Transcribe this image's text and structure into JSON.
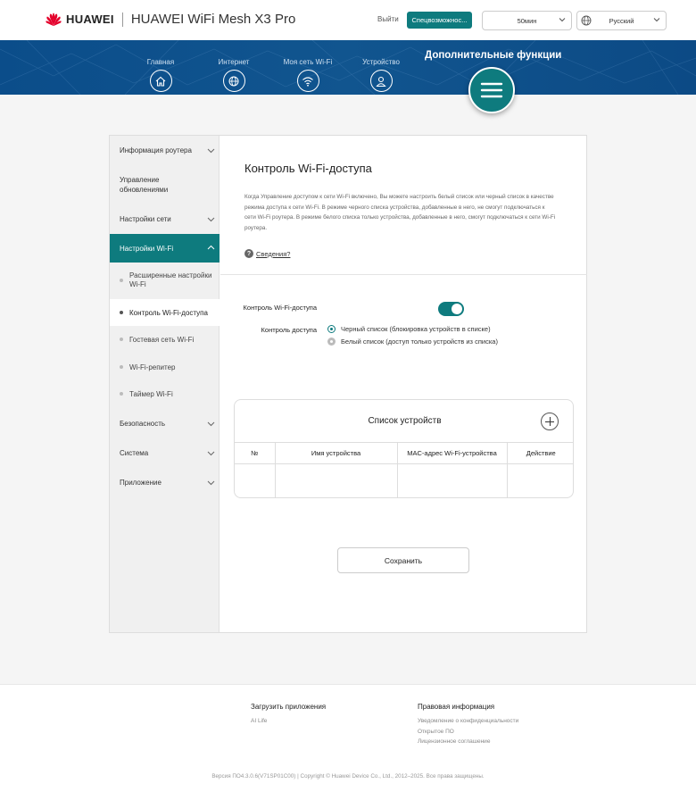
{
  "header": {
    "brand": "HUAWEI",
    "product": "HUAWEI WiFi Mesh X3 Pro",
    "logout": "Выйти",
    "accessibility": "Спецвозможнос...",
    "timeout": "50мин",
    "language": "Русский"
  },
  "nav": {
    "items": [
      {
        "label": "Главная",
        "icon": "home-icon"
      },
      {
        "label": "Интернет",
        "icon": "globe-icon"
      },
      {
        "label": "Моя сеть Wi-Fi",
        "icon": "wifi-icon"
      },
      {
        "label": "Устройство",
        "icon": "user-icon"
      }
    ],
    "extra": "Дополнительные функции",
    "menu_icon": "menu-icon"
  },
  "sidebar": {
    "items": [
      {
        "label": "Информация роутера"
      },
      {
        "label": "Управление обновлениями"
      },
      {
        "label": "Настройки сети"
      },
      {
        "label": "Настройки Wi-Fi"
      },
      {
        "label": "Безопасность"
      },
      {
        "label": "Система"
      },
      {
        "label": "Приложение"
      }
    ],
    "subitems": [
      {
        "label": "Расширенные настройки Wi-Fi"
      },
      {
        "label": "Контроль Wi-Fi-доступа"
      },
      {
        "label": "Гостевая сеть Wi-Fi"
      },
      {
        "label": "Wi-Fi-репитер"
      },
      {
        "label": "Таймер Wi-Fi"
      }
    ]
  },
  "main": {
    "title": "Контроль Wi-Fi-доступа",
    "description": "Когда Управление доступом к сети Wi-Fi включено, Вы можете настроить белый список или черный список в качестве режима доступа к сети Wi-Fi. В режиме черного списка устройства, добавленные в него, не смогут подключаться к сети Wi-Fi роутера. В режиме белого списка только устройства, добавленные в него, смогут подключаться к сети Wi-Fi роутера.",
    "info_link": "Сведения?",
    "toggle_label": "Контроль Wi-Fi-доступа",
    "toggle_on": true,
    "access_label": "Контроль доступа",
    "radio_black": "Черный список (блокировка устройств в списке)",
    "radio_white": "Белый список (доступ только устройств из списка)",
    "device_list": {
      "title": "Список устройств",
      "columns": [
        "№",
        "Имя устройства",
        "MAC-адрес Wi-Fi-устройства",
        "Действие"
      ]
    },
    "save": "Сохранить"
  },
  "footer": {
    "col1_head": "Загрузить приложения",
    "col1_links": [
      "AI Life"
    ],
    "col2_head": "Правовая информация",
    "col2_links": [
      "Уведомление о конфиденциальности",
      "Открытое ПО",
      "Лицензионное соглашение"
    ],
    "copyright": "Версия ПО4.3.0.6(V71SP01C00) | Copyright © Huawei Device Co., Ltd., 2012–2025. Все права защищены."
  },
  "colors": {
    "accent": "#0e7b7e",
    "banner": "#0b4d8a"
  }
}
